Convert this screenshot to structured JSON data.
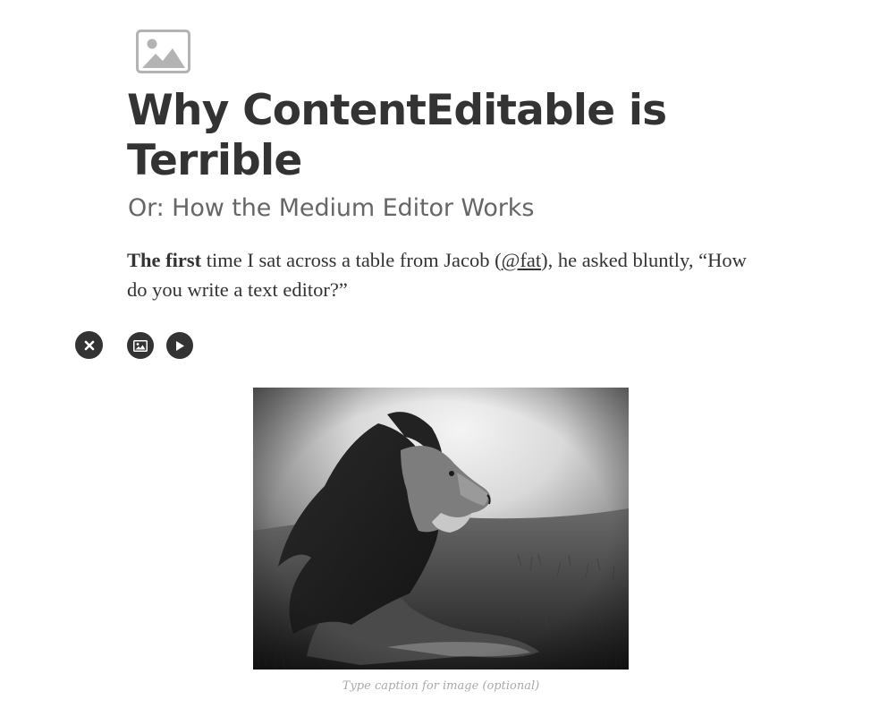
{
  "header_image": {
    "icon": "image-placeholder-icon",
    "color": "#b3b3b3"
  },
  "article": {
    "title": "Why ContentEditable is Terrible",
    "subtitle": "Or: How the Medium Editor Works",
    "paragraph": {
      "bold": "The first",
      "text_before_link": " time I sat across a table from Jacob (",
      "link": "@fat",
      "text_after_link": "), he asked bluntly, “How do you write a text editor?”"
    }
  },
  "insert_toolbar": {
    "buttons": [
      {
        "name": "close",
        "icon": "close-icon"
      },
      {
        "name": "insert-image",
        "icon": "image-icon"
      },
      {
        "name": "insert-video",
        "icon": "play-icon"
      }
    ],
    "button_color": "#333333"
  },
  "figure": {
    "image_subject": "black-and-white photo of a lion with a windswept mane",
    "caption_placeholder": "Type caption for image (optional)"
  }
}
